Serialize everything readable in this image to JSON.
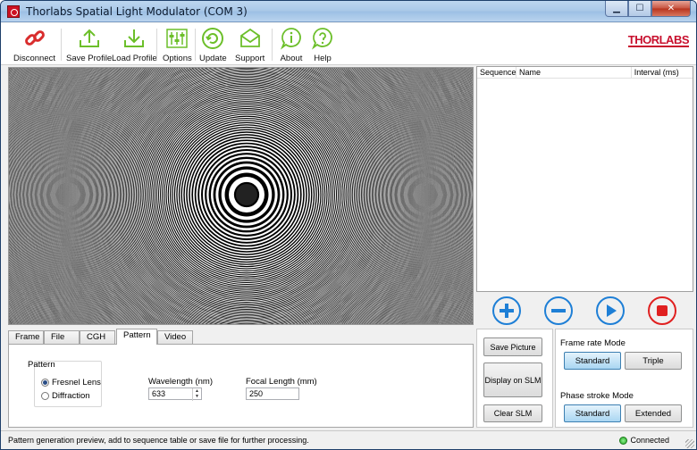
{
  "window": {
    "title": "Thorlabs Spatial Light Modulator (COM 3)"
  },
  "toolbar": {
    "disconnect": "Disconnect",
    "save_profile": "Save Profile",
    "load_profile": "Load Profile",
    "options": "Options",
    "update": "Update",
    "support": "Support",
    "about": "About",
    "help": "Help"
  },
  "logo": "THORLABS",
  "sequence_table": {
    "columns": [
      "Sequence",
      "Name",
      "Interval (ms)"
    ]
  },
  "tabs": [
    "Frame",
    "File",
    "CGH",
    "Pattern",
    "Video"
  ],
  "active_tab": "Pattern",
  "pattern_panel": {
    "group_label": "Pattern",
    "options": [
      "Fresnel Lens",
      "Diffraction"
    ],
    "selected_option": "Fresnel Lens",
    "wavelength_label": "Wavelength (nm)",
    "wavelength_value": "633",
    "focal_label": "Focal Length (mm)",
    "focal_value": "250"
  },
  "actions": {
    "save_picture": "Save Picture",
    "display_on_slm": "Display on SLM",
    "clear_slm": "Clear SLM"
  },
  "frame_rate": {
    "label": "Frame rate Mode",
    "standard": "Standard",
    "triple": "Triple",
    "selected": "Standard"
  },
  "phase_stroke": {
    "label": "Phase stroke Mode",
    "standard": "Standard",
    "extended": "Extended",
    "selected": "Standard"
  },
  "status": {
    "message": "Pattern generation preview, add to sequence table or save file for further processing.",
    "connection": "Connected"
  },
  "colors": {
    "accent_green": "#6cbf2a",
    "accent_blue": "#1e7fd6",
    "stop_red": "#e02020",
    "brand_red": "#c8102e"
  }
}
